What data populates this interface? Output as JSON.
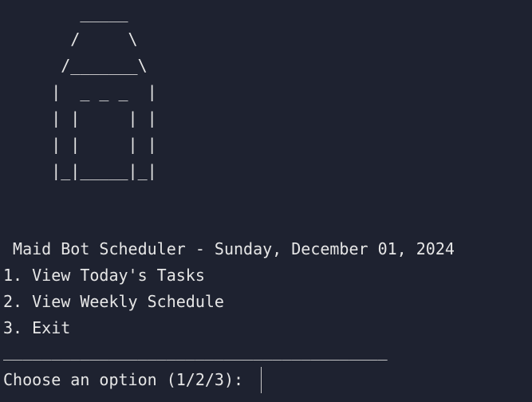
{
  "ascii_art": [
    "        _____",
    "       /     \\",
    "      /_______\\",
    "     |  _ _ _  |",
    "     | |     | |",
    "     | |     | |",
    "     |_|_____|_|"
  ],
  "header": {
    "title": " Maid Bot Scheduler - Sunday, December 01, 2024"
  },
  "menu": {
    "items": [
      {
        "label": "1. View Today's Tasks"
      },
      {
        "label": "2. View Weekly Schedule"
      },
      {
        "label": "3. Exit"
      }
    ]
  },
  "divider": "________________________________________",
  "prompt": {
    "text": "Choose an option (1/2/3):",
    "value": ""
  }
}
